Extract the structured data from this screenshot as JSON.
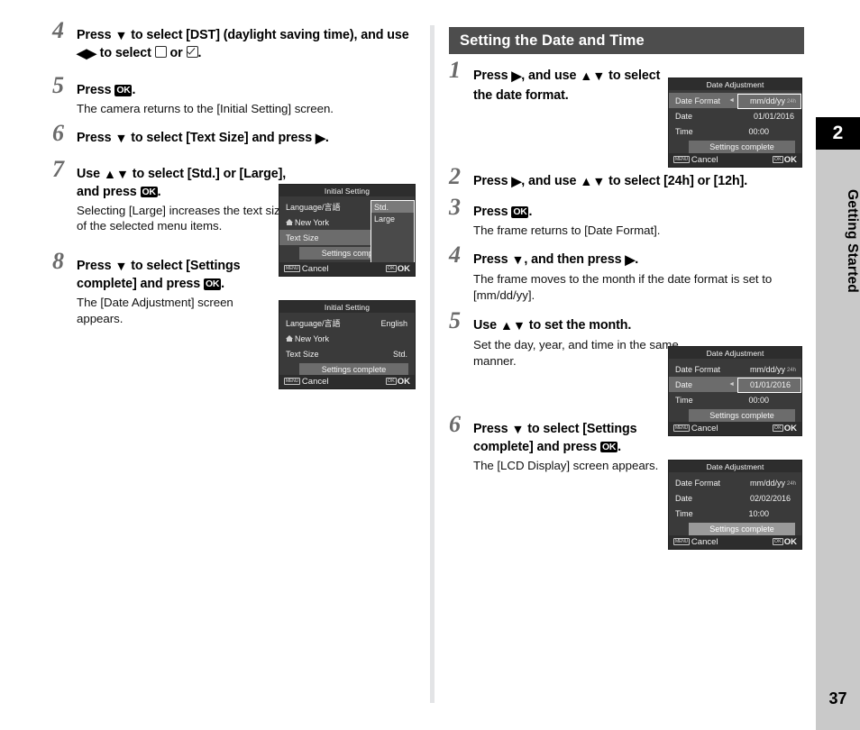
{
  "chapter": {
    "number": "2",
    "name": "Getting Started",
    "page_number": "37"
  },
  "left_column": {
    "steps": [
      {
        "num": "4",
        "title_parts": [
          "Press ",
          "▼",
          " to select [DST] (daylight saving time), and use ",
          "◀▶",
          " to select ",
          "☐",
          " or ",
          "☑",
          "."
        ],
        "title_plain": "Press ▼ to select [DST] (daylight saving time), and use ◀▶ to select ☐ or ☑.",
        "desc": ""
      },
      {
        "num": "5",
        "title_plain": "Press OK.",
        "desc": "The camera returns to the [Initial Setting] screen."
      },
      {
        "num": "6",
        "title_plain": "Press ▼ to select [Text Size] and press ▶.",
        "desc": ""
      },
      {
        "num": "7",
        "title_plain": "Use ▲▼ to select [Std.] or [Large], and press OK.",
        "desc": "Selecting [Large] increases the text size of the selected menu items."
      },
      {
        "num": "8",
        "title_plain": "Press ▼ to select [Settings complete] and press OK.",
        "desc": "The [Date Adjustment] screen appears."
      }
    ]
  },
  "right_column": {
    "section_header": "Setting the Date and Time",
    "steps": [
      {
        "num": "1",
        "title_plain": "Press ▶, and use ▲▼ to select the date format.",
        "desc": ""
      },
      {
        "num": "2",
        "title_plain": "Press ▶, and use ▲▼ to select [24h] or [12h].",
        "desc": ""
      },
      {
        "num": "3",
        "title_plain": "Press OK.",
        "desc": "The frame returns to [Date Format]."
      },
      {
        "num": "4",
        "title_plain": "Press ▼, and then press ▶.",
        "desc": "The frame moves to the month if the date format is set to [mm/dd/yy]."
      },
      {
        "num": "5",
        "title_plain": "Use ▲▼ to set the month.",
        "desc": "Set the day, year, and time in the same manner."
      },
      {
        "num": "6",
        "title_plain": "Press ▼ to select [Settings complete] and press OK.",
        "desc": "The [LCD Display] screen appears."
      }
    ]
  },
  "screens": {
    "initial_setting_textsize": {
      "title": "Initial Setting",
      "rows": [
        {
          "label": "Language/言語",
          "value": ""
        },
        {
          "label": "New York",
          "value": "",
          "home_icon": true
        },
        {
          "label": "Text Size",
          "value": "",
          "selected": true
        }
      ],
      "complete_label": "Settings complete",
      "popup_options": [
        "Std.",
        "Large"
      ],
      "popup_selected": "Std.",
      "cancel_label": "Cancel",
      "cancel_tag": "MENU",
      "ok_label": "OK",
      "ok_tag": "OK"
    },
    "initial_setting_done": {
      "title": "Initial Setting",
      "rows": [
        {
          "label": "Language/言語",
          "value": "English"
        },
        {
          "label": "New York",
          "value": "",
          "home_icon": true
        },
        {
          "label": "Text Size",
          "value": "Std."
        }
      ],
      "complete_label": "Settings complete",
      "cancel_label": "Cancel",
      "cancel_tag": "MENU",
      "ok_label": "OK",
      "ok_tag": "OK"
    },
    "date_adjustment_format": {
      "title": "Date Adjustment",
      "rows": [
        {
          "label": "Date Format",
          "value": "mm/dd/yy",
          "suffix": "24h",
          "selected": true,
          "framed": true
        },
        {
          "label": "Date",
          "value": "01/01/2016"
        },
        {
          "label": "Time",
          "value": "00:00"
        }
      ],
      "complete_label": "Settings complete",
      "cancel_label": "Cancel",
      "cancel_tag": "MENU",
      "ok_label": "OK",
      "ok_tag": "OK"
    },
    "date_adjustment_month": {
      "title": "Date Adjustment",
      "rows": [
        {
          "label": "Date Format",
          "value": "mm/dd/yy",
          "suffix": "24h"
        },
        {
          "label": "Date",
          "value": "01/01/2016",
          "selected": true,
          "framed": true
        },
        {
          "label": "Time",
          "value": "00:00"
        }
      ],
      "complete_label": "Settings complete",
      "cancel_label": "Cancel",
      "cancel_tag": "MENU",
      "ok_label": "OK",
      "ok_tag": "OK"
    },
    "date_adjustment_done": {
      "title": "Date Adjustment",
      "rows": [
        {
          "label": "Date Format",
          "value": "mm/dd/yy",
          "suffix": "24h"
        },
        {
          "label": "Date",
          "value": "02/02/2016"
        },
        {
          "label": "Time",
          "value": "10:00"
        }
      ],
      "complete_label": "Settings complete",
      "complete_dim": true,
      "cancel_label": "Cancel",
      "cancel_tag": "MENU",
      "ok_label": "OK",
      "ok_tag": "OK"
    }
  },
  "colors": {
    "header_bar": "#4d4d4d",
    "tab_gray": "#c9c9c9",
    "tab_black": "#000000",
    "step_num": "#6a6a6a",
    "lcd_bg": "#3a3a3a"
  }
}
